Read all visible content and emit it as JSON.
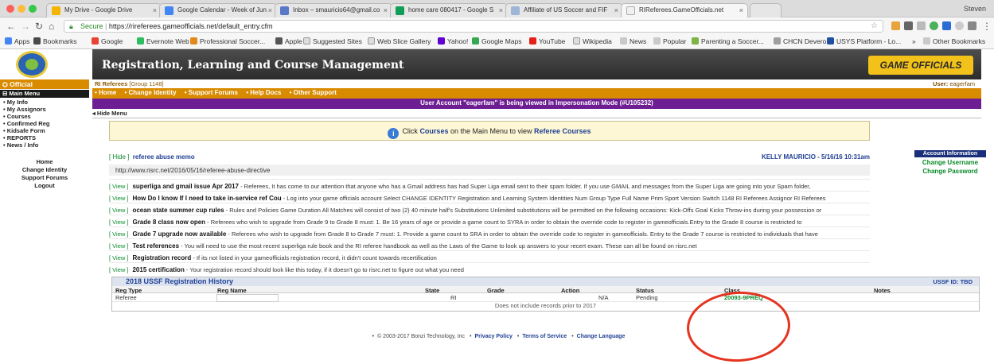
{
  "browser": {
    "profile": "Steven",
    "tabs": [
      {
        "title": "My Drive - Google Drive",
        "color": "#f4b400"
      },
      {
        "title": "Google Calendar - Week of Jun",
        "color": "#4285f4"
      },
      {
        "title": "Inbox – smauricio64@gmail.co",
        "color": "#5a78c8"
      },
      {
        "title": "home care 080417 - Google S",
        "color": "#0f9d58"
      },
      {
        "title": "Affiliate of US Soccer and FIF",
        "color": "#9db6d8"
      },
      {
        "title": "RIReferees.GameOfficials.net",
        "color": "#f0f0f0"
      }
    ],
    "secure_label": "Secure",
    "url": "https://rireferees.gameofficials.net/default_entry.cfm",
    "bookmarks": [
      "Apps",
      "Bookmarks",
      "Google",
      "Evernote Web",
      "Professional Soccer...",
      "Apple",
      "Suggested Sites",
      "Web Slice Gallery",
      "Yahoo!",
      "Google Maps",
      "YouTube",
      "Wikipedia",
      "News",
      "Popular",
      "Parenting a Soccer...",
      "CHCN Devero",
      "USYS Platform - Lo..."
    ],
    "other_bookmarks": "Other Bookmarks",
    "overflow": "»"
  },
  "sidebar": {
    "official_label": "Official",
    "main_menu": "Main Menu",
    "items": [
      "• My Info",
      "• My Assignors",
      "• Courses",
      "• Confirmed Reg",
      "• Kidsafe Form",
      "• REPORTS",
      "• News / Info"
    ],
    "links": [
      "Home",
      "Change Identity",
      "Support Forums",
      "Logout"
    ]
  },
  "header": {
    "title": "Registration, Learning and Course Management",
    "brand": "GAME OFFICIALS"
  },
  "account_bar": {
    "org": "RI Referees",
    "group": "[Group 1148]",
    "user_label": "User:",
    "username": "eagerfam"
  },
  "topnav": [
    "• Home",
    "• Change Identity",
    "• Support Forums",
    "• Help Docs",
    "• Other Support"
  ],
  "impersonation": "User Account \"eagerfam\" is being viewed in Impersonation Mode (#U105232)",
  "hide_menu": "◂ Hide Menu",
  "notice": {
    "pre": "Click ",
    "courses": "Courses",
    "mid": " on the Main Menu to view ",
    "referee_courses": "Referee Courses"
  },
  "account_info": {
    "title": "Account Information",
    "change_username": "Change Username",
    "change_password": "Change Password"
  },
  "memo": {
    "hide": "[ Hide ]",
    "title": "referee abuse memo",
    "author": "KELLY MAURICIO - 5/16/16 10:31am",
    "body": "http://www.risrc.net/2016/05/16/referee-abuse-directive"
  },
  "news": [
    {
      "view": "[ View ]",
      "title": "superliga and gmail issue Apr 2017",
      "body": " - Referees, It has come to our attention that anyone who has a Gmail address has had Super Liga email sent to their spam folder. If you use GMAIL and messages from the Super Liga are going into your Spam folder,"
    },
    {
      "view": "[ View ]",
      "title": "How Do I know If I need to take in-service ref Cou",
      "body": " - Log into your game officials account Select CHANGE IDENTITY Registration and Learning System Identities Num Group Type Full Name Prim Sport Version Switch 1148 RI Referees Assignor RI Referees"
    },
    {
      "view": "[ View ]",
      "title": "ocean state summer cup rules",
      "body": " - Rules and Policies Game Duration All Matches will consist of two (2) 40 minute half's Substitutions Unlimited substitutions will be permitted on the following occasions: Kick-Offs Goal Kicks Throw-ins during your possession or"
    },
    {
      "view": "[ View ]",
      "title": "Grade 8 class now open",
      "body": " - Referees who wish to upgrade from Grade 9 to Grade 8 must: 1. Be 16 years of age or provide a game count to SYRA in order to obtain the override code to register in gameofficials.Entry to the Grade 8 course is restricted to"
    },
    {
      "view": "[ View ]",
      "title": "Grade 7 upgrade now available",
      "body": " - Referees who wish to upgrade from Grade 8 to Grade 7 must: 1. Provide a game count to SRA in order to obtain the override code to register in gameofficials. Entry to the Grade 7 course is restricted to individuals that have"
    },
    {
      "view": "[ View ]",
      "title": "Test references",
      "body": " - You will need to use the most recent superliga rule book and the RI referee handbook as well as the Laws of the Game to look up answers to your recert exam. These can all be found on risrc.net"
    },
    {
      "view": "[ View ]",
      "title": "Registration record",
      "body": " - If its not listed in your gameofficials registration record, it didn't count towards recertification"
    },
    {
      "view": "[ View ]",
      "title": "2015 certification",
      "body": " - Your registration record should look like this today, if it doesn't go to risrc.net to figure out what you need"
    }
  ],
  "history": {
    "title": "2018 USSF Registration History",
    "ussf_id": "USSF ID: TBD",
    "columns": [
      "Reg Type",
      "Reg Name",
      "State",
      "Grade",
      "Action",
      "Status",
      "Class",
      "Notes"
    ],
    "row": {
      "reg_type": "Referee",
      "reg_name": "",
      "state": "RI",
      "grade": "",
      "action": "N/A",
      "status": "Pending",
      "class": "20093-9PREQ",
      "notes": ""
    },
    "footnote": "Does not include records prior to 2017"
  },
  "footer": {
    "copyright": "© 2003-2017 Bonzi Technology, Inc",
    "privacy": "Privacy Policy",
    "terms": "Terms of Service",
    "language": "Change Language"
  }
}
